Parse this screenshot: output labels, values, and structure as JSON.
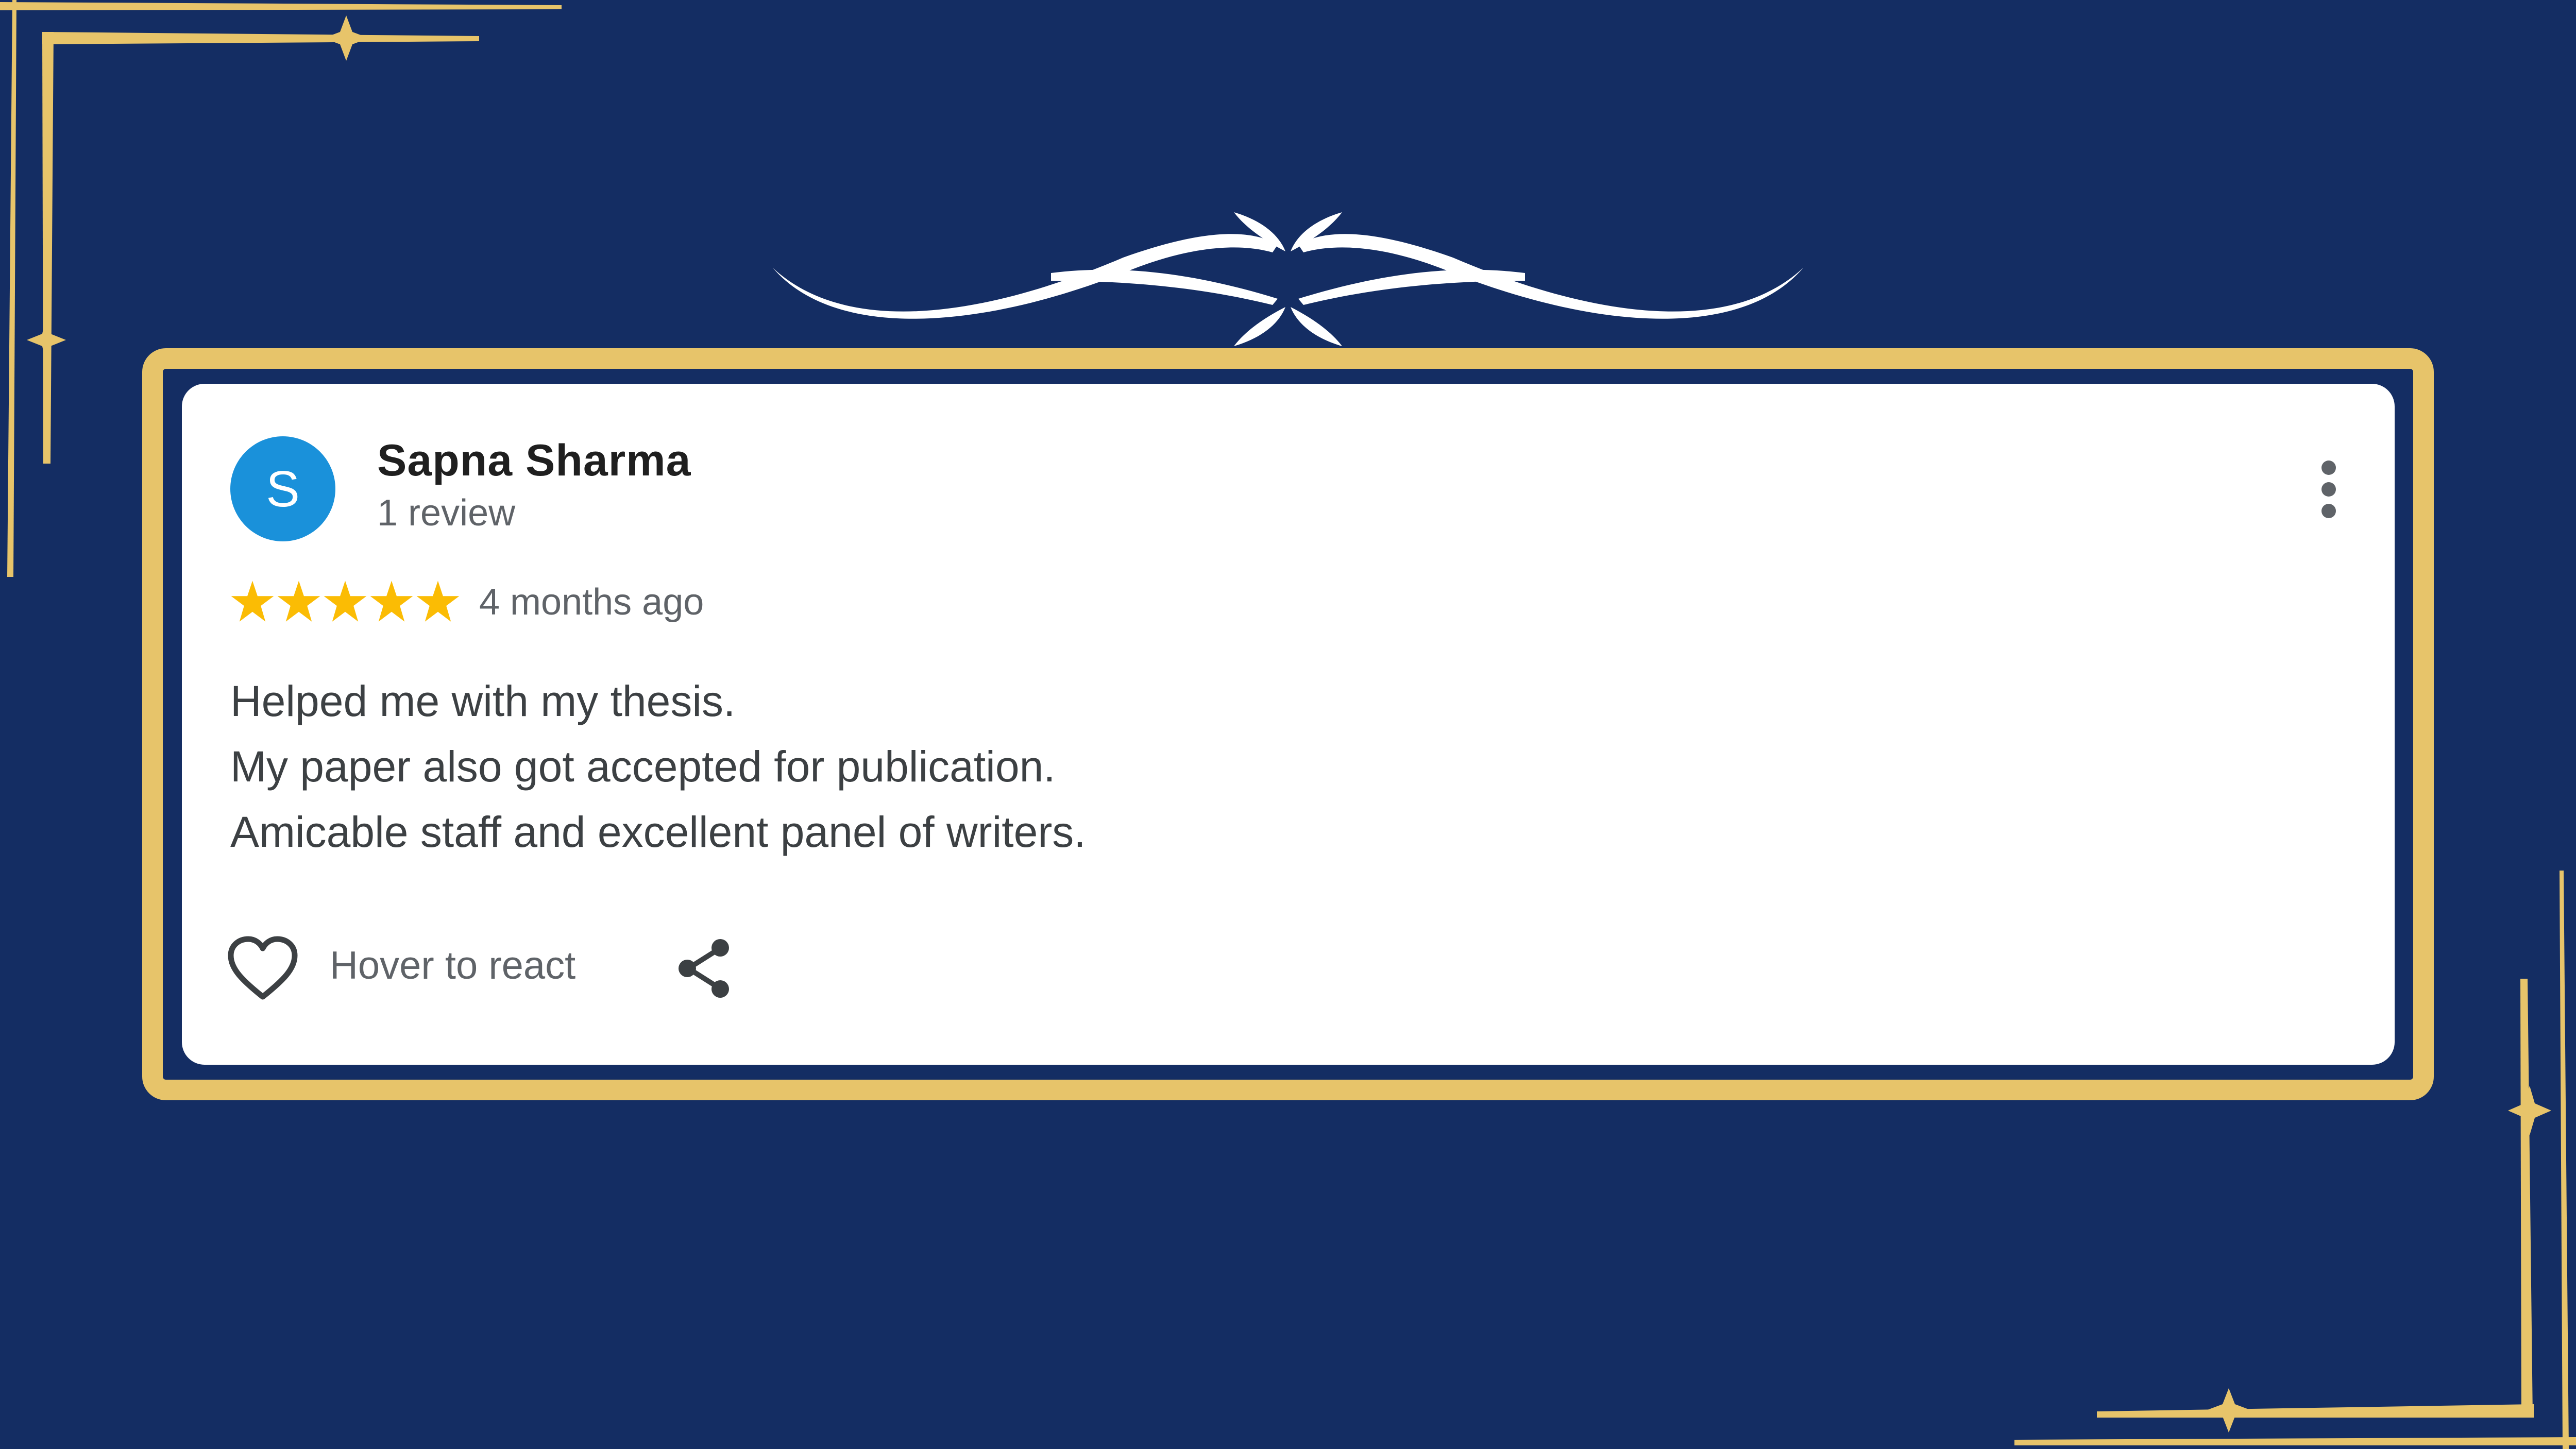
{
  "colors": {
    "background": "#142d63",
    "gold": "#e7c46a",
    "card": "#ffffff",
    "avatar": "#1a91da",
    "star": "#fbbc04",
    "secondary_text": "#5f6368"
  },
  "review": {
    "avatar_initial": "S",
    "author": "Sapna Sharma",
    "review_count": "1 review",
    "rating": 5,
    "max_rating": 5,
    "date": "4 months ago",
    "lines": [
      "Helped me with my thesis.",
      "My paper also got accepted for publication.",
      "Amicable staff and excellent panel of writers."
    ]
  },
  "actions": {
    "react_label": "Hover to react",
    "icons": {
      "more": "more-vertical-icon",
      "react": "heart-icon",
      "share": "share-icon"
    }
  }
}
